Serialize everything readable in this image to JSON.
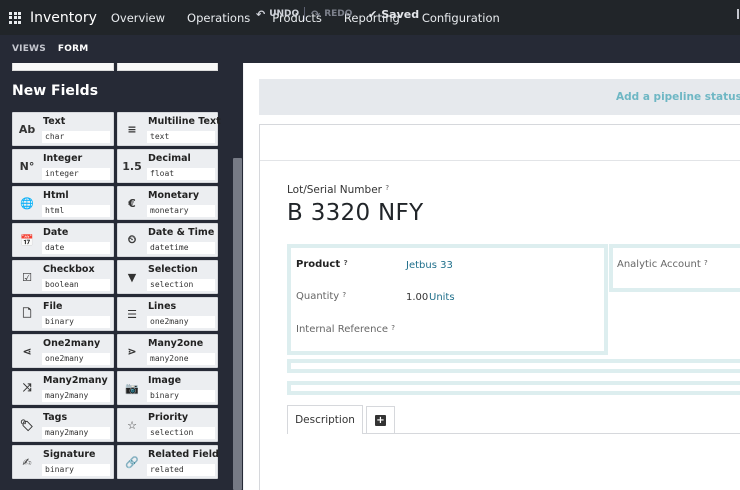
{
  "navbar": {
    "app_name": "Inventory",
    "menu": [
      "Overview",
      "Operations",
      "Products",
      "Reporting",
      "Configuration"
    ]
  },
  "toolbar": {
    "views_label": "VIEWS",
    "form_label": "FORM",
    "undo_label": "UNDO",
    "redo_label": "REDO",
    "saved_label": "Saved"
  },
  "sidebar": {
    "title": "New Fields",
    "fields": [
      {
        "label": "Text",
        "type": "char",
        "icon": "text-ab-icon",
        "glyph": "Ab"
      },
      {
        "label": "Multiline Text",
        "type": "text",
        "icon": "paragraph-icon",
        "glyph": "≡"
      },
      {
        "label": "Integer",
        "type": "integer",
        "icon": "number-icon",
        "glyph": "N°"
      },
      {
        "label": "Decimal",
        "type": "float",
        "icon": "decimal-icon",
        "glyph": "1.5"
      },
      {
        "label": "Html",
        "type": "html",
        "icon": "globe-icon",
        "glyph": "🌐"
      },
      {
        "label": "Monetary",
        "type": "monetary",
        "icon": "euro-icon",
        "glyph": "€"
      },
      {
        "label": "Date",
        "type": "date",
        "icon": "calendar-icon",
        "glyph": "📅"
      },
      {
        "label": "Date & Time",
        "type": "datetime",
        "icon": "clock-icon",
        "glyph": "⏲"
      },
      {
        "label": "Checkbox",
        "type": "boolean",
        "icon": "checkbox-icon",
        "glyph": "☑"
      },
      {
        "label": "Selection",
        "type": "selection",
        "icon": "caret-down-icon",
        "glyph": "▼"
      },
      {
        "label": "File",
        "type": "binary",
        "icon": "file-icon",
        "glyph": "🗋"
      },
      {
        "label": "Lines",
        "type": "one2many",
        "icon": "list-icon",
        "glyph": "☰"
      },
      {
        "label": "One2many",
        "type": "one2many",
        "icon": "share-icon",
        "glyph": "⋖"
      },
      {
        "label": "Many2one",
        "type": "many2one",
        "icon": "many2one-icon",
        "glyph": "⋗"
      },
      {
        "label": "Many2many",
        "type": "many2many",
        "icon": "random-icon",
        "glyph": "⤨"
      },
      {
        "label": "Image",
        "type": "binary",
        "icon": "camera-icon",
        "glyph": "📷"
      },
      {
        "label": "Tags",
        "type": "many2many",
        "icon": "tag-icon",
        "glyph": "🏷"
      },
      {
        "label": "Priority",
        "type": "selection",
        "icon": "star-icon",
        "glyph": "☆"
      },
      {
        "label": "Signature",
        "type": "binary",
        "icon": "signature-icon",
        "glyph": "✍"
      },
      {
        "label": "Related Field",
        "type": "related",
        "icon": "link-icon",
        "glyph": "🔗"
      }
    ]
  },
  "form": {
    "statusbar_hint": "Add a pipeline status bar",
    "lot_label": "Lot/Serial Number",
    "lot_help": "?",
    "lot_value": "B 3320 NFY",
    "product_label": "Product",
    "product_help": "?",
    "product_value": "Jetbus 33",
    "quantity_label": "Quantity",
    "quantity_help": "?",
    "quantity_value": "1.00",
    "quantity_unit": "Units",
    "internal_ref_label": "Internal Reference",
    "internal_ref_help": "?",
    "analytic_label": "Analytic Account",
    "analytic_help": "?",
    "tabs": [
      "Description"
    ]
  }
}
